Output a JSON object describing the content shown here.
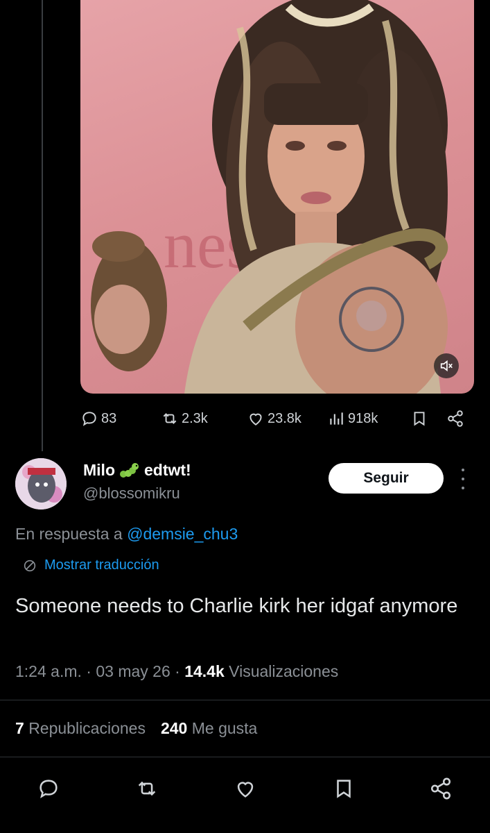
{
  "quoted_tweet": {
    "actions": {
      "replies": "83",
      "reposts": "2.3k",
      "likes": "23.8k",
      "views": "918k"
    },
    "media": {
      "text_fragment": "nes"
    }
  },
  "reply": {
    "display_name": "Milo",
    "name_suffix": "edtwt!",
    "handle": "@blossomikru",
    "follow_label": "Seguir",
    "reply_to_prefix": "En respuesta a",
    "reply_to_handle": "@demsie_chu3",
    "translate_label": "Mostrar traducción",
    "text": "Someone needs to Charlie kirk her idgaf anymore",
    "time": "1:24 a.m.",
    "date": "03 may 26",
    "views_count": "14.4k",
    "views_label": "Visualizaciones",
    "reposts_count": "7",
    "reposts_label": "Republicaciones",
    "likes_count": "240",
    "likes_label": "Me gusta"
  },
  "icons": [
    "reply-icon",
    "repost-icon",
    "like-icon",
    "views-icon",
    "bookmark-icon",
    "share-icon",
    "mute-icon",
    "translate-icon",
    "caterpillar-emoji"
  ],
  "colors": {
    "accent": "#1d9bf0",
    "background": "#000000",
    "secondary_text": "#8b9096"
  }
}
